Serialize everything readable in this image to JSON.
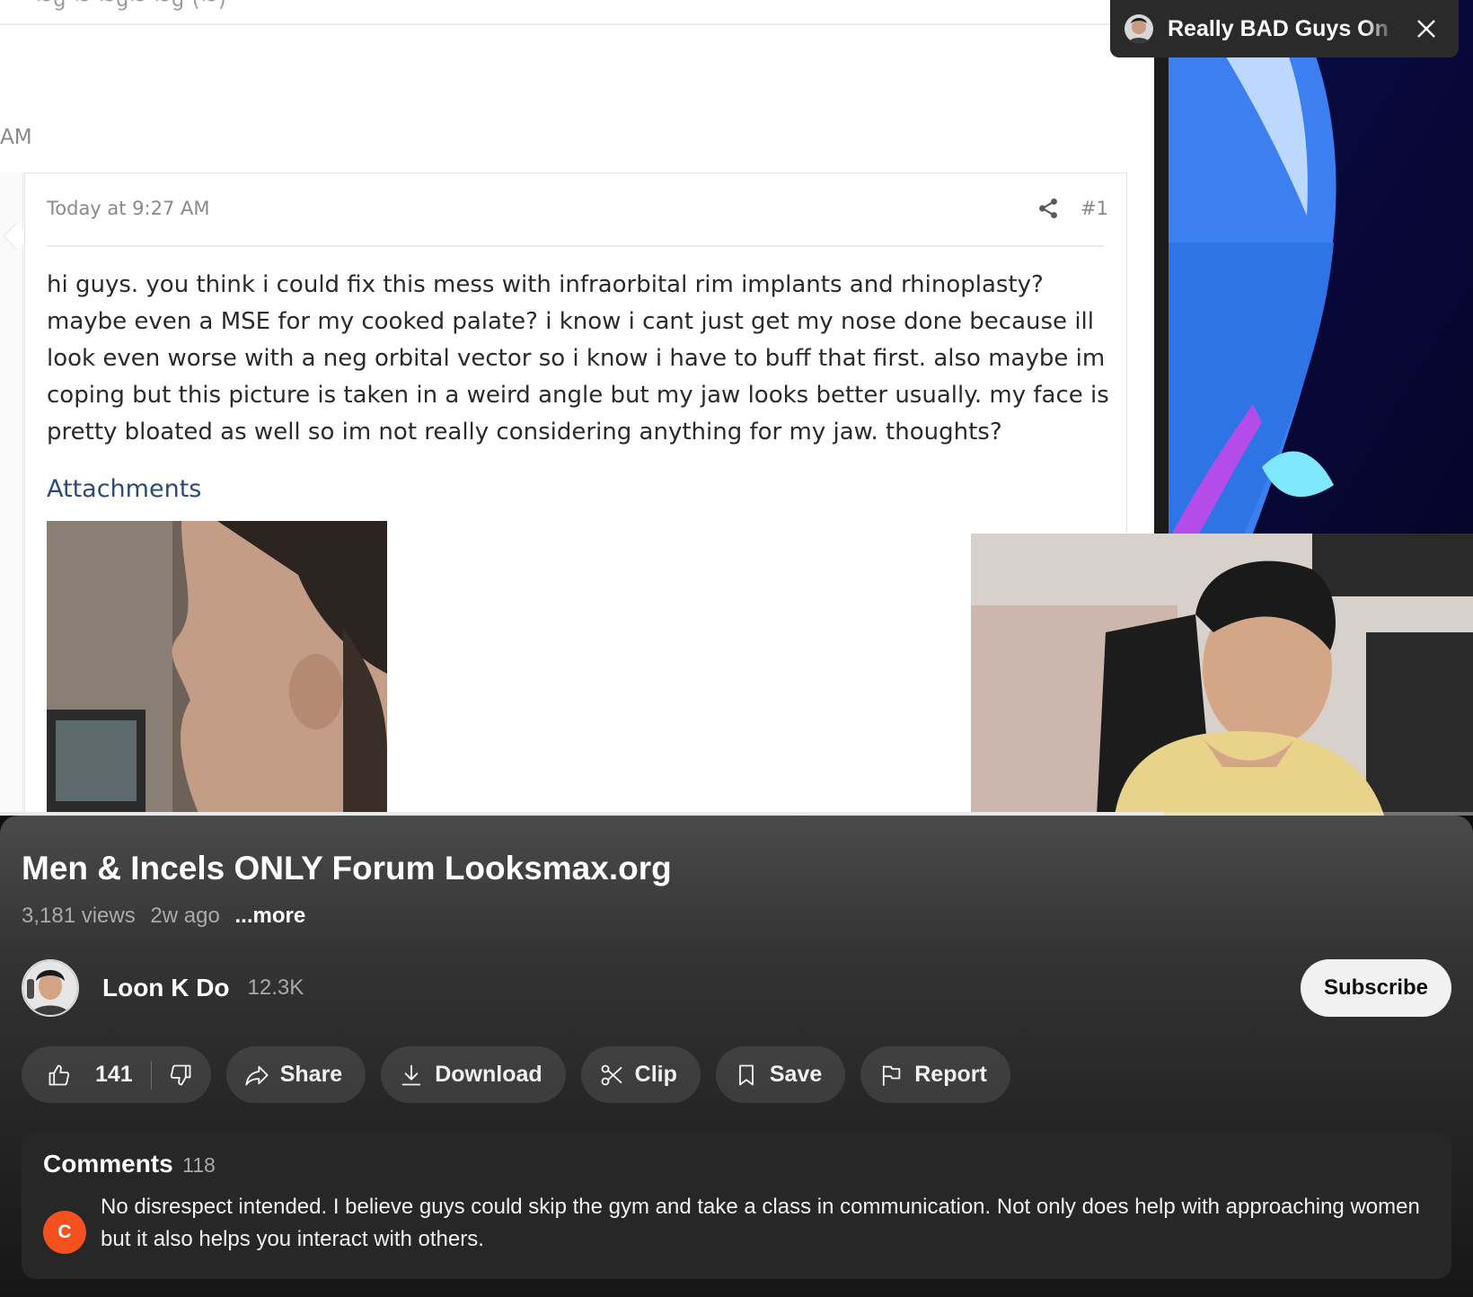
{
  "video": {
    "forum": {
      "top_cut_text": "~g              ~ ~g~              ~g (~)",
      "time_fragment": "AM",
      "post_date": "Today at 9:27 AM",
      "post_number": "#1",
      "post_text": "hi guys. you think i could fix this mess with infraorbital rim implants and rhinoplasty? maybe even a MSE for my cooked palate? i know i cant just get my nose done because ill look even worse with a neg orbital vector so i know i have to buff that first. also maybe im coping but this picture is taken in a weird angle but my jaw looks better usually. my face is pretty bloated as well so im not really considering anything for my jaw. thoughts?",
      "attachments_label": "Attachments"
    },
    "progress_fraction": 0.79,
    "miniplayer": {
      "title": "Really BAD Guys On r/",
      "close_icon": "close-icon"
    }
  },
  "info": {
    "title": "Men & Incels ONLY Forum Looksmax.org",
    "views": "3,181 views",
    "age": "2w ago",
    "more": "...more",
    "channel": {
      "name": "Loon K Do",
      "subscribers": "12.3K",
      "subscribe_label": "Subscribe"
    },
    "actions": {
      "like_count": "141",
      "share": "Share",
      "download": "Download",
      "clip": "Clip",
      "save": "Save",
      "report": "Report"
    },
    "comments": {
      "label": "Comments",
      "count": "118",
      "first": {
        "avatar_letter": "C",
        "avatar_color": "#f4511e",
        "text": "No disrespect intended. I believe guys could skip the gym and take a class in communication. Not only does help with approaching women but it also helps you interact with others."
      }
    }
  },
  "colors": {
    "panel_bg": "#1e1e1e",
    "pill_bg": "#3a3a3a",
    "subscribe_bg": "#f1f1f1",
    "forum_link": "#2b4a7a"
  }
}
